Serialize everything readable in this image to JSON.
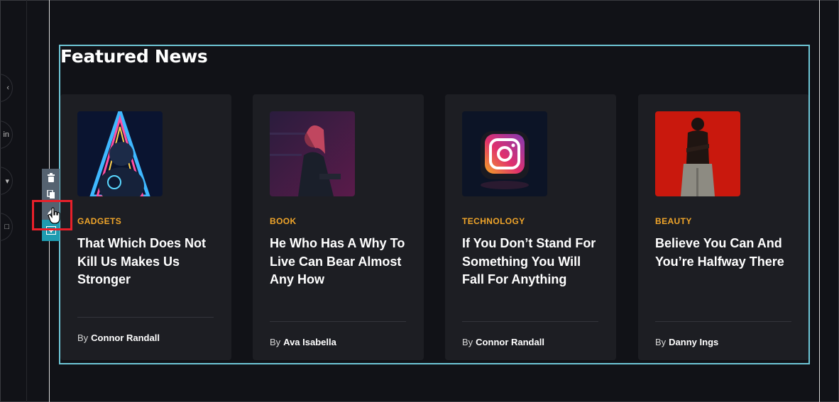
{
  "section": {
    "title": "Featured News"
  },
  "cards": [
    {
      "category": "GADGETS",
      "title": "That Which Does Not Kill Us Makes Us Stronger",
      "by": "By",
      "author": "Connor Randall"
    },
    {
      "category": "BOOK",
      "title": "He Who Has A Why To Live Can Bear Almost Any How",
      "by": "By",
      "author": "Ava Isabella"
    },
    {
      "category": "TECHNOLOGY",
      "title": "If You Don’t Stand For Something You Will Fall For Anything",
      "by": "By",
      "author": "Connor Randall"
    },
    {
      "category": "BEAUTY",
      "title": "Believe You Can And You’re Halfway There",
      "by": "By",
      "author": "Danny Ings"
    }
  ],
  "toolbar": {
    "icons": [
      "trash-icon",
      "duplicate-icon",
      "edit-icon",
      "add-section-icon"
    ]
  },
  "colors": {
    "background": "#111217",
    "card": "#1d1e23",
    "category": "#f0a52a",
    "section_outline": "#6ec6d6",
    "highlight": "#e8202a",
    "toolbar": "#556270",
    "toolbar_accent": "#1e9bb0"
  }
}
